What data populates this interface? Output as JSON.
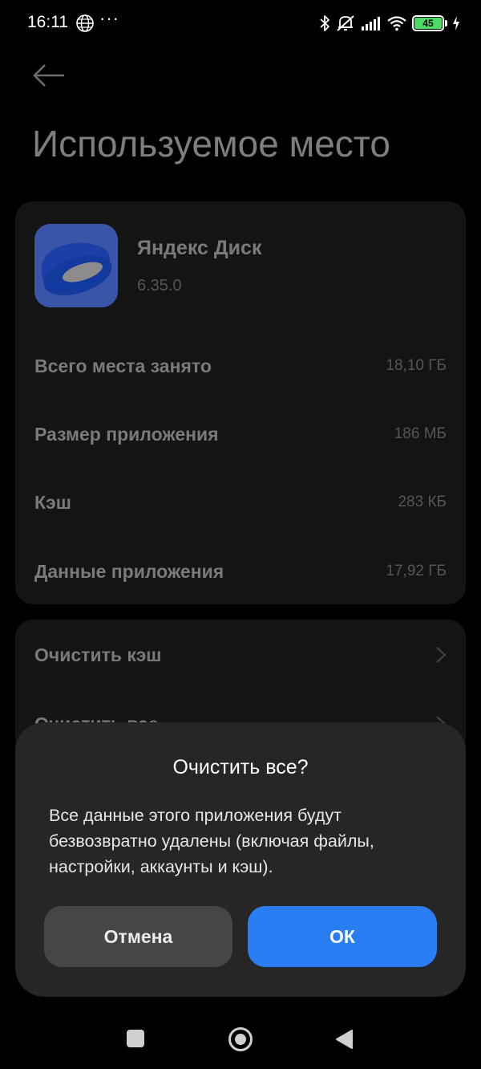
{
  "status_bar": {
    "time": "16:11",
    "dots": "···",
    "battery": "45",
    "icons": [
      "globe-icon",
      "bluetooth-icon",
      "mute-icon",
      "signal-icon",
      "wifi-icon",
      "battery-icon",
      "charging-icon"
    ]
  },
  "header": {
    "title": "Используемое место"
  },
  "app": {
    "name": "Яндекс Диск",
    "version": "6.35.0",
    "icon_color": "#3a55a8"
  },
  "storage": {
    "rows": [
      {
        "label": "Всего места занято",
        "value": "18,10 ГБ"
      },
      {
        "label": "Размер приложения",
        "value": "186 МБ"
      },
      {
        "label": "Кэш",
        "value": "283 КБ"
      },
      {
        "label": "Данные приложения",
        "value": "17,92 ГБ"
      }
    ]
  },
  "actions": [
    {
      "label": "Очистить кэш"
    },
    {
      "label": "Очистить все"
    }
  ],
  "dialog": {
    "title": "Очистить все?",
    "message": "Все данные этого приложения будут безвозвратно удалены (включая файлы, настройки, аккаунты и кэш).",
    "cancel_label": "Отмена",
    "ok_label": "ОК"
  },
  "colors": {
    "accent": "#2a7ef4",
    "dialog_bg": "#262626",
    "card_bg": "#141414"
  }
}
